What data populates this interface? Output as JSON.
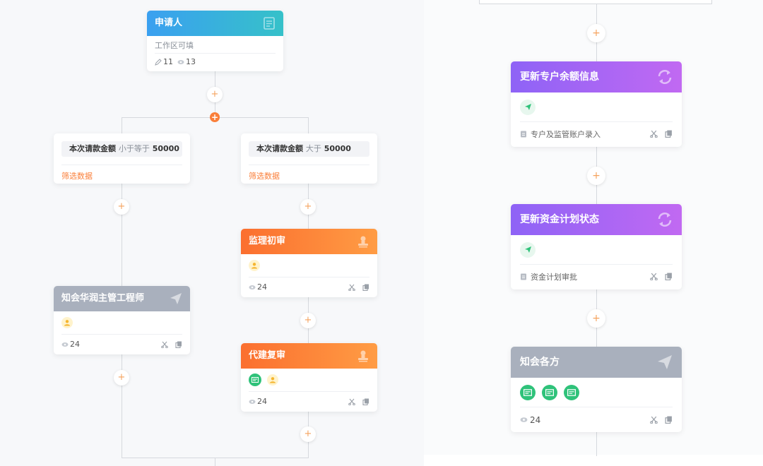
{
  "left": {
    "applicant": {
      "title": "申请人",
      "workspace": "工作区可填",
      "edit_count": "11",
      "view_count": "13"
    },
    "condition_left": {
      "field": "本次请款金额",
      "op": "小于等于",
      "value": "50000",
      "filter": "筛选数据"
    },
    "condition_right": {
      "field": "本次请款金额",
      "op": "大于",
      "value": "50000",
      "filter": "筛选数据"
    },
    "jianli": {
      "title": "监理初审",
      "view_count": "24"
    },
    "zhihui_hr": {
      "title": "知会华润主管工程师",
      "view_count": "24"
    },
    "daijian": {
      "title": "代建复审",
      "view_count": "24"
    },
    "add_symbol": "+"
  },
  "right": {
    "update_balance": {
      "title": "更新专户余额信息",
      "form_name": "专户及监管账户录入"
    },
    "update_plan": {
      "title": "更新资金计划状态",
      "form_name": "资金计划审批"
    },
    "zhihui_all": {
      "title": "知会各方",
      "view_count": "24"
    }
  },
  "colors": {
    "blue_head": "#3aa0f0",
    "orange_head": "#fb6f2f",
    "gray_head": "#a9b0bd",
    "purple_head": "#8e63f6",
    "add_accent": "#f5a25d",
    "filter_link": "#fa7f3a",
    "green_badge": "#2fc27a"
  }
}
